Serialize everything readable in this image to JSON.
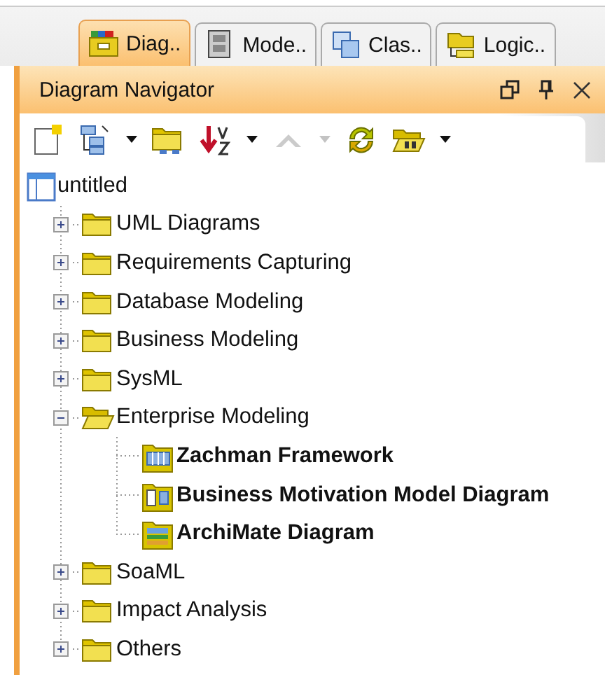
{
  "tabs": [
    {
      "label": "Diag..",
      "selected": true
    },
    {
      "label": "Mode..",
      "selected": false
    },
    {
      "label": "Clas..",
      "selected": false
    },
    {
      "label": "Logic..",
      "selected": false
    }
  ],
  "panel": {
    "title": "Diagram Navigator"
  },
  "toolbar": [
    {
      "kind": "new",
      "disabled": false
    },
    {
      "kind": "layout",
      "disabled": false
    },
    {
      "kind": "folder-link",
      "disabled": false
    },
    {
      "kind": "sort",
      "disabled": false
    },
    {
      "kind": "up",
      "disabled": true
    },
    {
      "kind": "refresh",
      "disabled": false
    },
    {
      "kind": "open-folder",
      "disabled": false
    }
  ],
  "tree": {
    "label": "untitled",
    "children": [
      {
        "label": "UML Diagrams",
        "kind": "folder",
        "expanded": false
      },
      {
        "label": "Requirements Capturing",
        "kind": "folder",
        "expanded": false
      },
      {
        "label": "Database Modeling",
        "kind": "folder",
        "expanded": false
      },
      {
        "label": "Business Modeling",
        "kind": "folder",
        "expanded": false
      },
      {
        "label": "SysML",
        "kind": "folder",
        "expanded": false
      },
      {
        "label": "Enterprise Modeling",
        "kind": "folder",
        "expanded": true,
        "children": [
          {
            "label": "Zachman Framework",
            "kind": "diagram"
          },
          {
            "label": "Business Motivation Model Diagram",
            "kind": "diagram"
          },
          {
            "label": "ArchiMate Diagram",
            "kind": "diagram"
          }
        ]
      },
      {
        "label": "SoaML",
        "kind": "folder",
        "expanded": false
      },
      {
        "label": "Impact Analysis",
        "kind": "folder",
        "expanded": false
      },
      {
        "label": "Others",
        "kind": "folder",
        "expanded": false
      }
    ]
  }
}
